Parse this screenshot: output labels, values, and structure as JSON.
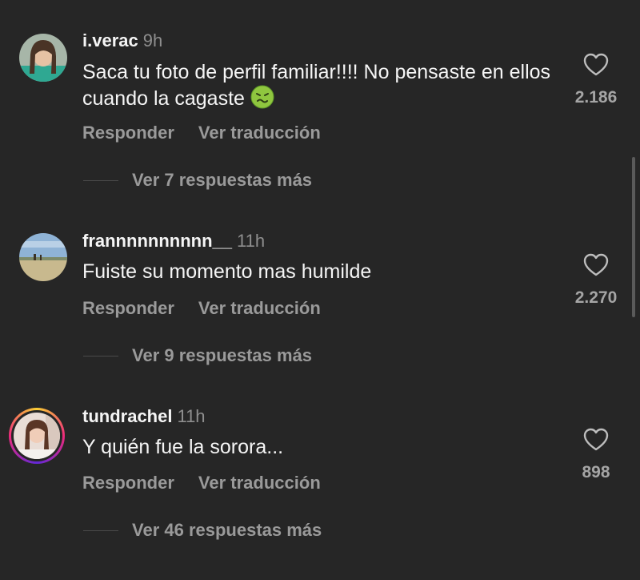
{
  "comments": [
    {
      "username": "i.verac",
      "time": "9h",
      "text": "Saca tu foto de perfil familiar!!!! No pensaste en ellos cuando la cagaste",
      "emoji": "nauseated-face-emoji",
      "reply_label": "Responder",
      "translate_label": "Ver traducción",
      "view_replies": "Ver 7 respuestas más",
      "likes": "2.186"
    },
    {
      "username": "frannnnnnnnnn__",
      "time": "11h",
      "text": "Fuiste su momento mas humilde",
      "reply_label": "Responder",
      "translate_label": "Ver traducción",
      "view_replies": "Ver 9 respuestas más",
      "likes": "2.270"
    },
    {
      "username": "tundrachel",
      "time": "11h",
      "text": "Y quién fue la sorora...",
      "reply_label": "Responder",
      "translate_label": "Ver traducción",
      "view_replies": "Ver 46 respuestas más",
      "likes": "898"
    }
  ],
  "colors": {
    "background": "#262626",
    "text": "#f5f5f5",
    "muted": "#9a9a9a"
  }
}
